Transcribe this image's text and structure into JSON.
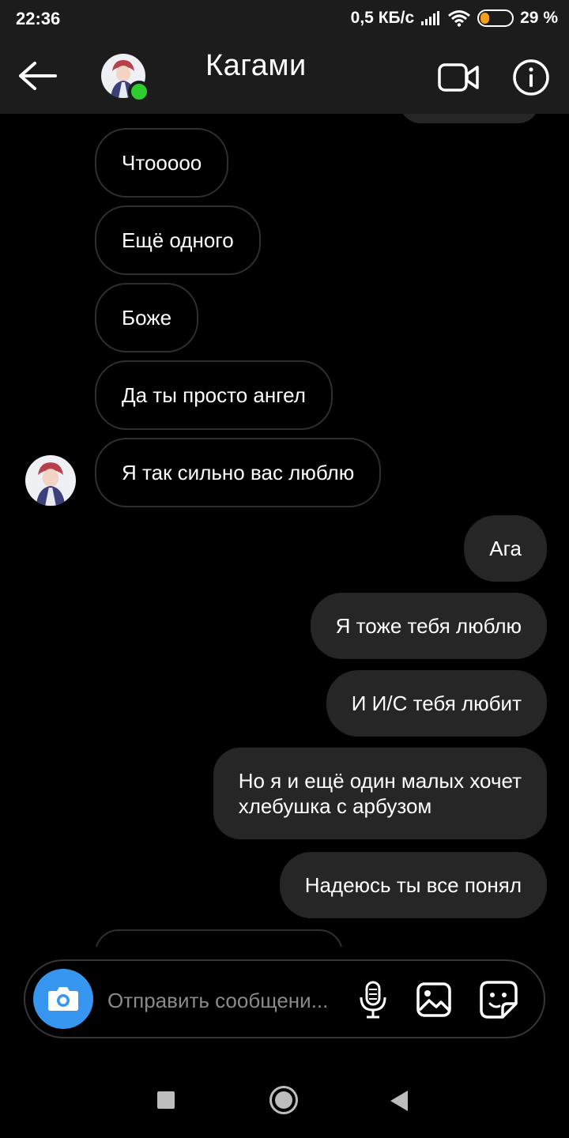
{
  "status_bar": {
    "time": "22:36",
    "net_speed": "0,5 КБ/с",
    "battery_text": "29 %",
    "battery_level": 0.29,
    "battery_color": "#f2a21a"
  },
  "header": {
    "title": "Кагами",
    "online": true,
    "online_color": "#2ecc2e"
  },
  "messages": [
    {
      "id": "m1",
      "dir": "in",
      "text": "Чтооооо"
    },
    {
      "id": "m2",
      "dir": "in",
      "text": "Ещё одного"
    },
    {
      "id": "m3",
      "dir": "in",
      "text": "Боже"
    },
    {
      "id": "m4",
      "dir": "in",
      "text": "Да ты просто ангел"
    },
    {
      "id": "m5",
      "dir": "in",
      "text": "Я так сильно вас люблю"
    },
    {
      "id": "m6",
      "dir": "out",
      "text": "Ага"
    },
    {
      "id": "m7",
      "dir": "out",
      "text": "Я тоже тебя люблю"
    },
    {
      "id": "m8",
      "dir": "out",
      "text": "И И/С тебя любит"
    },
    {
      "id": "m9",
      "dir": "out",
      "text_line1": "Но я и ещё один малых хочет",
      "text_line2": "хлебушка с арбузом"
    },
    {
      "id": "m10",
      "dir": "out",
      "text": "Надеюсь ты все понял"
    }
  ],
  "composer": {
    "placeholder": "Отправить сообщени...",
    "camera_color": "#3797f0"
  },
  "icons": {
    "back": "arrow-left-icon",
    "video": "video-camera-icon",
    "info": "info-icon",
    "camera": "camera-icon",
    "mic": "microphone-icon",
    "gallery": "image-icon",
    "sticker": "sticker-icon"
  }
}
